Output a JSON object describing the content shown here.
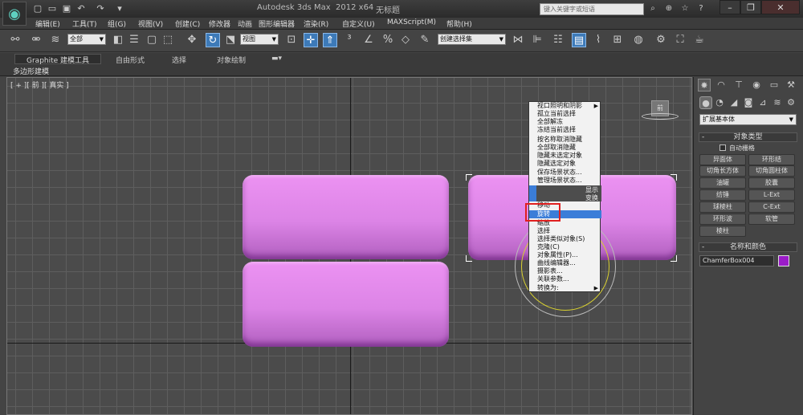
{
  "title_bar": {
    "app_title": "Autodesk 3ds Max  2012 x64",
    "doc_title": "无标题",
    "search_placeholder": "键入关键字或短语"
  },
  "quick_access": [
    "new-file-icon",
    "open-icon",
    "save-icon",
    "undo-icon",
    "redo-icon",
    "dropdown-icon"
  ],
  "menus": [
    "编辑(E)",
    "工具(T)",
    "组(G)",
    "视图(V)",
    "创建(C)",
    "修改器",
    "动画",
    "图形编辑器",
    "渲染(R)",
    "自定义(U)",
    "MAXScript(M)",
    "帮助(H)"
  ],
  "toolbar": {
    "selection_filter": "全部",
    "reference_coord": "视图",
    "named_selection": "创建选择集"
  },
  "ribbon": {
    "tabs": [
      "Graphite 建模工具",
      "自由形式",
      "选择",
      "对象绘制"
    ],
    "active_tab": "Graphite 建模工具",
    "sub_label": "多边形建模"
  },
  "viewport": {
    "label": "[ + ][ 前 ][ 真实 ]",
    "viewcube_label": "前",
    "object_color": "#dc84e6",
    "grid_color": "#5e5e5e"
  },
  "quad_menu": {
    "items_top": [
      "视口照明和阴影",
      "孤立当前选择",
      "全部解冻",
      "冻结当前选择",
      "按名称取消隐藏",
      "全部取消隐藏",
      "隐藏未选定对象",
      "隐藏选定对象",
      "保存场景状态...",
      "管理场景状态..."
    ],
    "header_display": "显示",
    "header_transform": "变换",
    "items_bottom": [
      "移动",
      "旋转",
      "缩放",
      "选择",
      "选择类似对象(S)",
      "克隆(C)",
      "对象属性(P)...",
      "曲线编辑器...",
      "摄影表...",
      "关联参数...",
      "转换为:"
    ],
    "highlighted_item": "旋转",
    "highlight_color": "#3b7dd8"
  },
  "command_panel": {
    "category_dropdown": "扩展基本体",
    "rollout_object_type": "对象类型",
    "autogrid_label": "自动栅格",
    "object_buttons": [
      "异面体",
      "环形结",
      "切角长方体",
      "切角圆柱体",
      "油罐",
      "胶囊",
      "纺锤",
      "L-Ext",
      "球棱柱",
      "C-Ext",
      "环形波",
      "软管",
      "棱柱"
    ],
    "rollout_name_color": "名称和颜色",
    "object_name": "ChamferBox004",
    "object_color": "#9b1cc8"
  }
}
